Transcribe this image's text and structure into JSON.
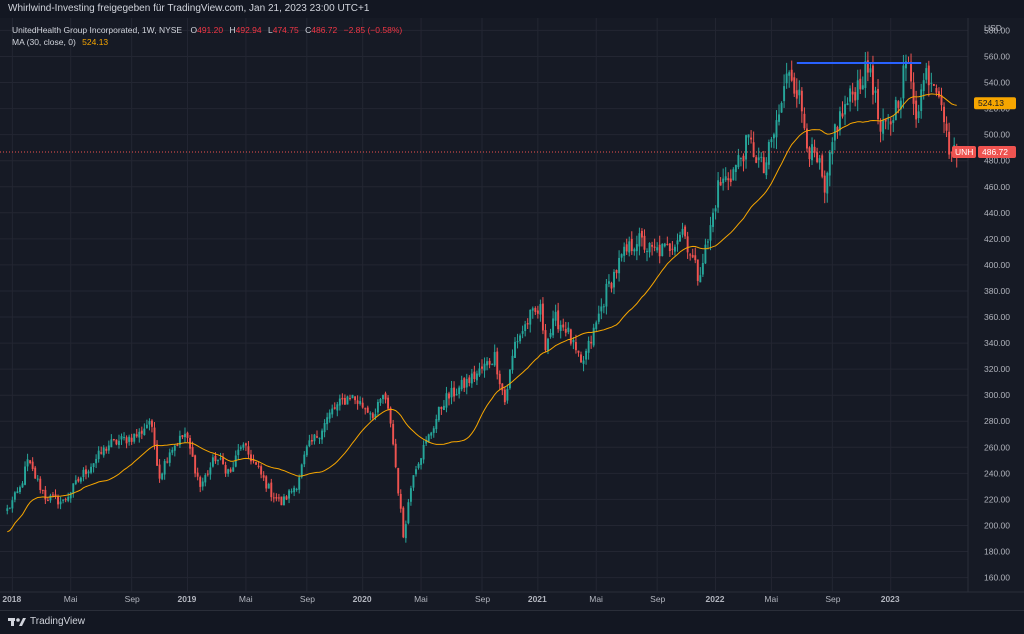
{
  "header": {
    "publish_line": "Whirlwind-Investing freigegeben für TradingView.com, Jan 21, 2023 23:00 UTC+1"
  },
  "legend": {
    "symbol": "UnitedHealth Group Incorporated, 1W, NYSE",
    "o_label": "O",
    "o_value": "491.20",
    "h_label": "H",
    "h_value": "492.94",
    "l_label": "L",
    "l_value": "474.75",
    "c_label": "C",
    "c_value": "486.72",
    "change": "−2.85 (−0.58%)",
    "ma_label": "MA (30, close, 0)",
    "ma_value": "524.13"
  },
  "footer": {
    "brand": "TradingView"
  },
  "colors": {
    "up": "#26a69a",
    "down": "#ef5350",
    "ma": "#f7a600",
    "resistance": "#2962ff",
    "background": "#161a25",
    "grid": "#232632"
  },
  "chart_data": {
    "type": "candlestick",
    "currency_label": "USD",
    "y_ticks": [
      "580.00",
      "560.00",
      "540.00",
      "520.00",
      "500.00",
      "480.00",
      "460.00",
      "440.00",
      "420.00",
      "400.00",
      "380.00",
      "360.00",
      "340.00",
      "320.00",
      "300.00",
      "280.00",
      "260.00",
      "240.00",
      "220.00",
      "200.00",
      "180.00",
      "160.00"
    ],
    "ylim": [
      152,
      588
    ],
    "x_ticks": [
      {
        "label": "2018",
        "bold": true
      },
      {
        "label": "Mai",
        "bold": false
      },
      {
        "label": "Sep",
        "bold": false
      },
      {
        "label": "2019",
        "bold": true
      },
      {
        "label": "Mai",
        "bold": false
      },
      {
        "label": "Sep",
        "bold": false
      },
      {
        "label": "2020",
        "bold": true
      },
      {
        "label": "Mai",
        "bold": false
      },
      {
        "label": "Sep",
        "bold": false
      },
      {
        "label": "2021",
        "bold": true
      },
      {
        "label": "Mai",
        "bold": false
      },
      {
        "label": "Sep",
        "bold": false
      },
      {
        "label": "2022",
        "bold": true
      },
      {
        "label": "Mai",
        "bold": false
      },
      {
        "label": "Sep",
        "bold": false
      },
      {
        "label": "2023",
        "bold": true
      }
    ],
    "anchors": [
      [
        0,
        212
      ],
      [
        5,
        228
      ],
      [
        8,
        249
      ],
      [
        15,
        222
      ],
      [
        22,
        218
      ],
      [
        30,
        240
      ],
      [
        40,
        262
      ],
      [
        52,
        270
      ],
      [
        56,
        281
      ],
      [
        58,
        262
      ],
      [
        60,
        238
      ],
      [
        64,
        258
      ],
      [
        70,
        270
      ],
      [
        72,
        258
      ],
      [
        76,
        230
      ],
      [
        82,
        252
      ],
      [
        88,
        240
      ],
      [
        92,
        262
      ],
      [
        96,
        252
      ],
      [
        104,
        225
      ],
      [
        108,
        217
      ],
      [
        114,
        232
      ],
      [
        118,
        258
      ],
      [
        123,
        272
      ],
      [
        128,
        288
      ],
      [
        135,
        300
      ],
      [
        140,
        292
      ],
      [
        145,
        285
      ],
      [
        148,
        300
      ],
      [
        151,
        280
      ],
      [
        155,
        210
      ],
      [
        156,
        192
      ],
      [
        160,
        242
      ],
      [
        166,
        268
      ],
      [
        172,
        296
      ],
      [
        178,
        305
      ],
      [
        186,
        318
      ],
      [
        192,
        330
      ],
      [
        196,
        295
      ],
      [
        200,
        340
      ],
      [
        206,
        360
      ],
      [
        210,
        365
      ],
      [
        212,
        340
      ],
      [
        216,
        358
      ],
      [
        220,
        352
      ],
      [
        226,
        322
      ],
      [
        230,
        342
      ],
      [
        236,
        380
      ],
      [
        242,
        405
      ],
      [
        248,
        420
      ],
      [
        254,
        410
      ],
      [
        260,
        412
      ],
      [
        266,
        428
      ],
      [
        272,
        392
      ],
      [
        276,
        418
      ],
      [
        280,
        460
      ],
      [
        286,
        472
      ],
      [
        292,
        495
      ],
      [
        298,
        472
      ],
      [
        304,
        515
      ],
      [
        308,
        552
      ],
      [
        312,
        528
      ],
      [
        316,
        488
      ],
      [
        320,
        474
      ],
      [
        322,
        452
      ],
      [
        326,
        505
      ],
      [
        332,
        528
      ],
      [
        336,
        542
      ],
      [
        340,
        552
      ],
      [
        344,
        500
      ],
      [
        348,
        510
      ],
      [
        352,
        535
      ],
      [
        354,
        558
      ],
      [
        358,
        518
      ],
      [
        362,
        548
      ],
      [
        366,
        540
      ],
      [
        368,
        530
      ],
      [
        370,
        497
      ],
      [
        372,
        486
      ],
      [
        374,
        484
      ]
    ],
    "moving_average": {
      "name": "MA (30, close, 0)",
      "period": 30,
      "last_value": 524.13
    },
    "resistance_line": {
      "level": 555,
      "from_week": 311,
      "to_week": 360
    },
    "last_price": {
      "symbol": "UNH",
      "value": "486.72"
    },
    "ma_price": {
      "value": "524.13"
    },
    "last_close": 486.72,
    "last_open": 491.2,
    "last_high": 492.94,
    "last_low": 474.75,
    "weeks": 375
  }
}
